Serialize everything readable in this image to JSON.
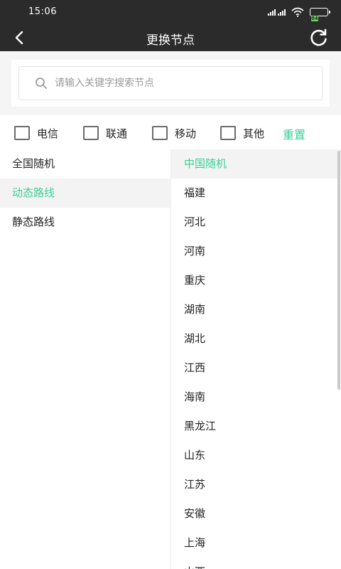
{
  "status_bar": {
    "time": "15:06",
    "battery_level": "84",
    "signal_icon": "signal-icon",
    "wifi_icon": "wifi-icon",
    "battery_icon": "battery-icon"
  },
  "header": {
    "title": "更换节点",
    "back_icon": "back-arrow-icon",
    "refresh_icon": "refresh-icon"
  },
  "search": {
    "placeholder": "请输入关键字搜索节点",
    "value": ""
  },
  "filters": {
    "options": [
      {
        "label": "电信",
        "checked": false
      },
      {
        "label": "联通",
        "checked": false
      },
      {
        "label": "移动",
        "checked": false
      },
      {
        "label": "其他",
        "checked": false
      }
    ],
    "reset_label": "重置"
  },
  "categories": {
    "items": [
      "全国随机",
      "动态路线",
      "静态路线"
    ],
    "selected_index": 1
  },
  "regions": {
    "items": [
      "中国随机",
      "福建",
      "河北",
      "河南",
      "重庆",
      "湖南",
      "湖北",
      "江西",
      "海南",
      "黑龙江",
      "山东",
      "江苏",
      "安徽",
      "上海",
      "山西"
    ],
    "selected_index": 0
  },
  "colors": {
    "accent": "#3ccf95",
    "header_bg": "#2b2b2b",
    "search_area_bg": "#f5f5f5",
    "selected_row_bg": "#f3f3f3",
    "battery_green": "#6fd267"
  }
}
